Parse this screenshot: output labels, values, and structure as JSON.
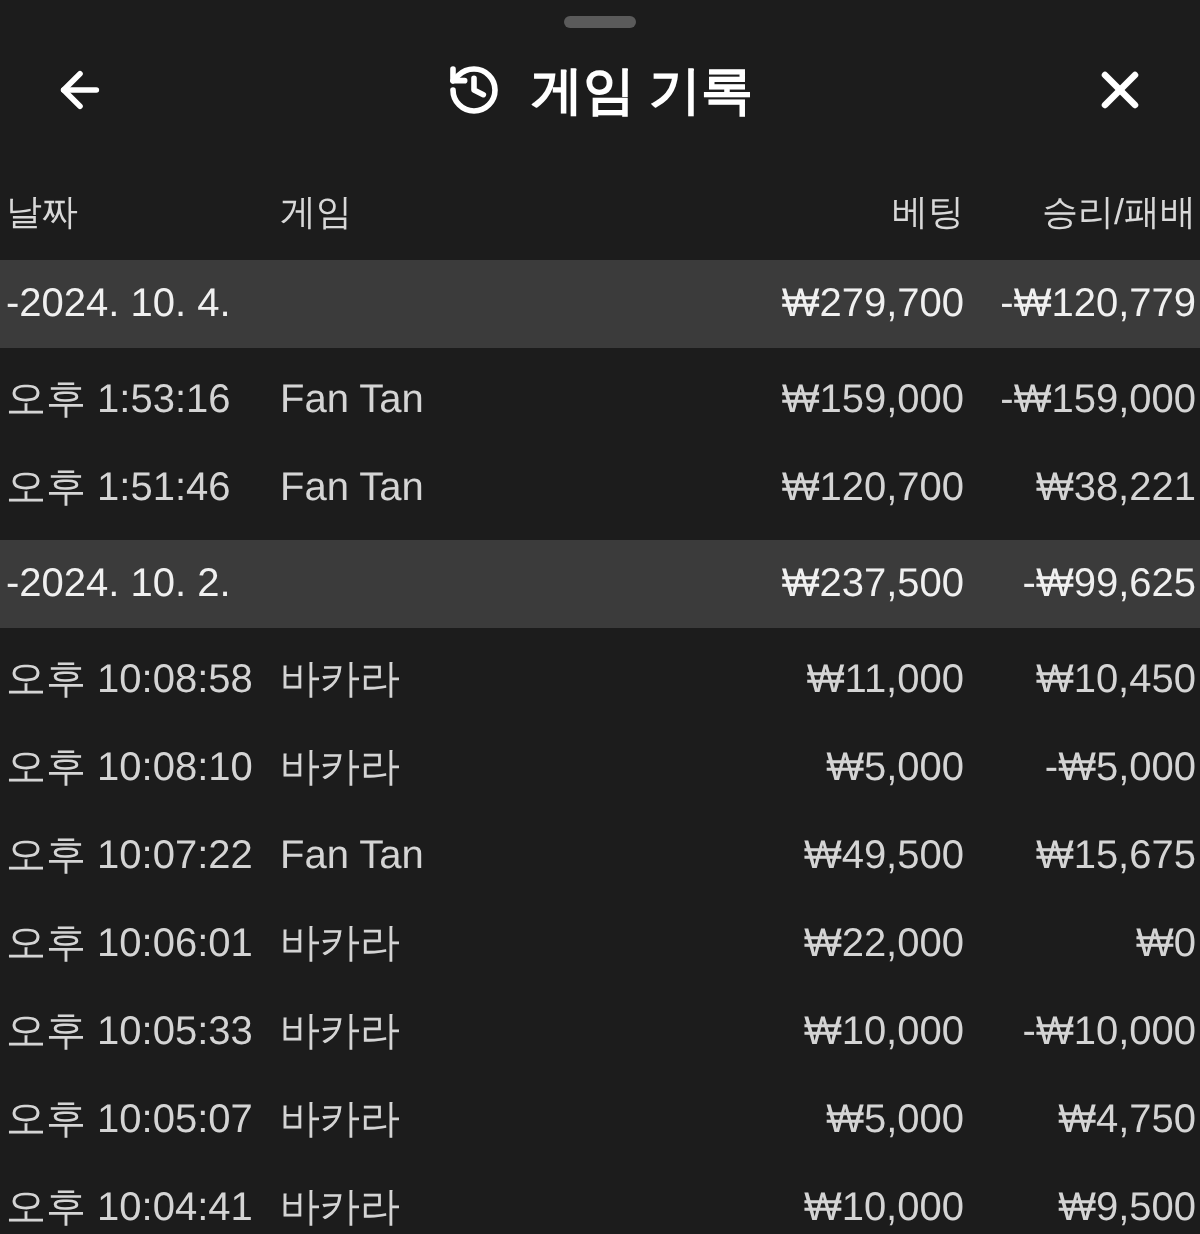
{
  "header": {
    "title": "게임 기록"
  },
  "table": {
    "columns": [
      "날짜",
      "게임",
      "베팅",
      "승리/패배"
    ],
    "groups": [
      {
        "date": "-2024. 10. 4.",
        "bet": "₩279,700",
        "result": "-₩120,779",
        "rows": [
          {
            "time": "오후 1:53:16",
            "game": "Fan Tan",
            "bet": "₩159,000",
            "result": "-₩159,000"
          },
          {
            "time": "오후 1:51:46",
            "game": "Fan Tan",
            "bet": "₩120,700",
            "result": "₩38,221"
          }
        ]
      },
      {
        "date": "-2024. 10. 2.",
        "bet": "₩237,500",
        "result": "-₩99,625",
        "rows": [
          {
            "time": "오후 10:08:58",
            "game": "바카라",
            "bet": "₩11,000",
            "result": "₩10,450"
          },
          {
            "time": "오후 10:08:10",
            "game": "바카라",
            "bet": "₩5,000",
            "result": "-₩5,000"
          },
          {
            "time": "오후 10:07:22",
            "game": "Fan Tan",
            "bet": "₩49,500",
            "result": "₩15,675"
          },
          {
            "time": "오후 10:06:01",
            "game": "바카라",
            "bet": "₩22,000",
            "result": "₩0"
          },
          {
            "time": "오후 10:05:33",
            "game": "바카라",
            "bet": "₩10,000",
            "result": "-₩10,000"
          },
          {
            "time": "오후 10:05:07",
            "game": "바카라",
            "bet": "₩5,000",
            "result": "₩4,750"
          },
          {
            "time": "오후 10:04:41",
            "game": "바카라",
            "bet": "₩10,000",
            "result": "₩9,500"
          }
        ]
      }
    ]
  }
}
